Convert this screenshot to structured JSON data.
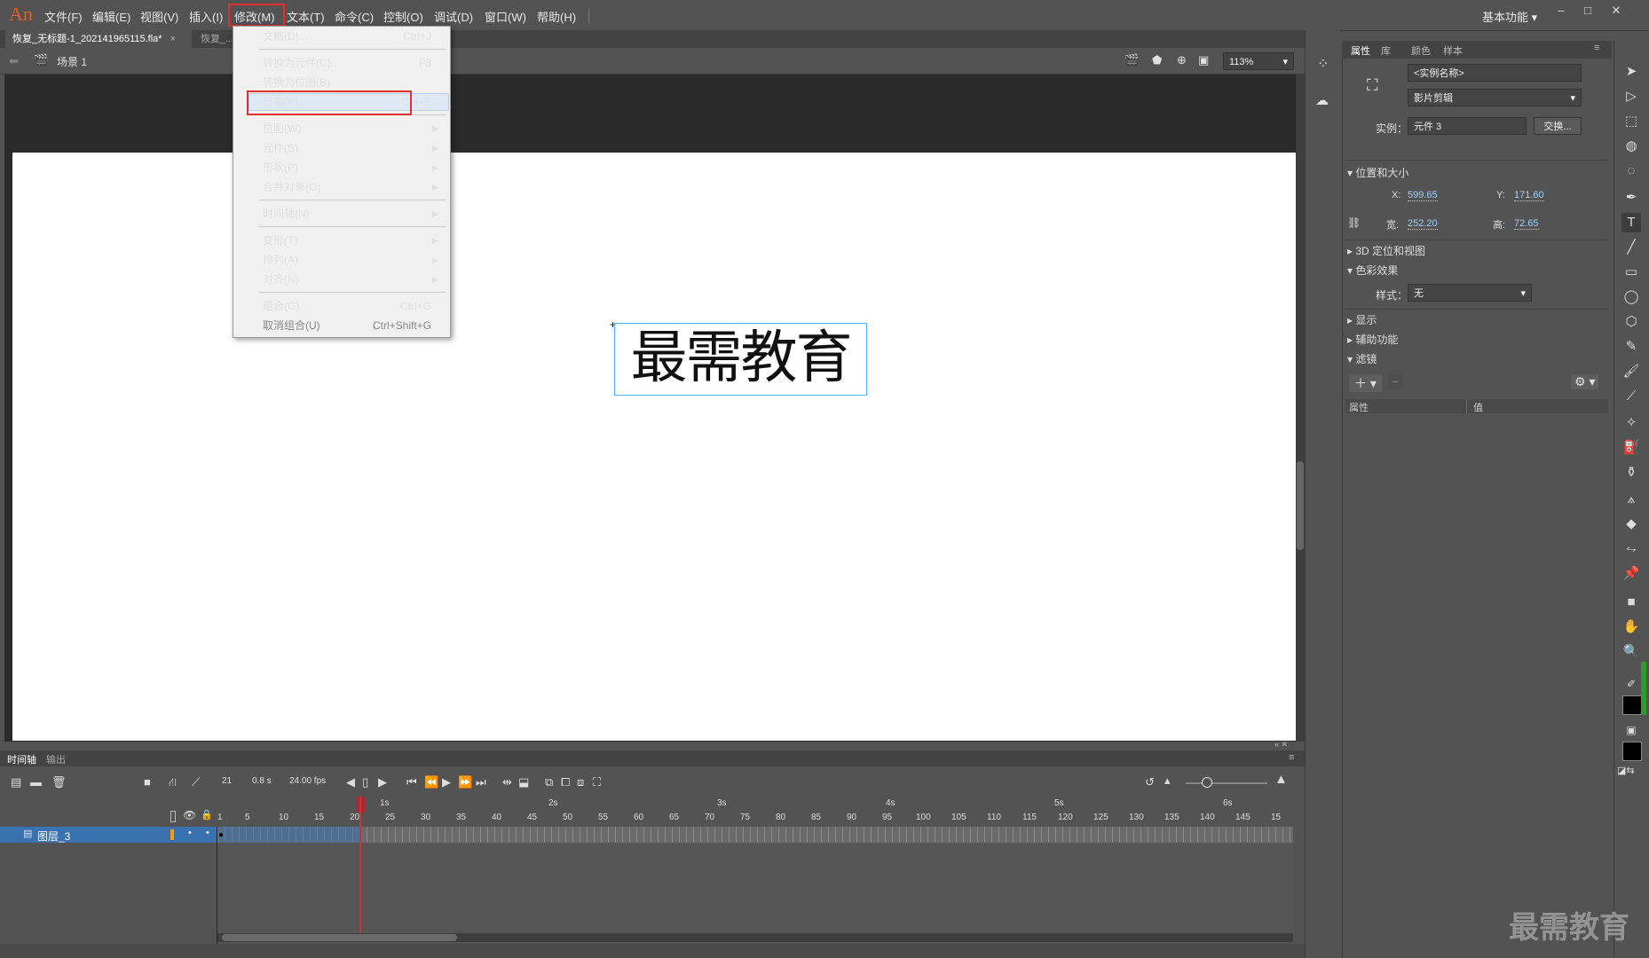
{
  "app": {
    "logo": "An",
    "menus": [
      "文件(F)",
      "编辑(E)",
      "视图(V)",
      "插入(I)",
      "修改(M)",
      "文本(T)",
      "命令(C)",
      "控制(O)",
      "调试(D)",
      "窗口(W)",
      "帮助(H)"
    ],
    "workspace": "基本功能",
    "window_buttons": [
      "–",
      "□",
      "✕"
    ]
  },
  "doc_tabs": {
    "active": "恢复_无标题-1_202141965115.fla*",
    "active_close": "×",
    "second": "恢复_..."
  },
  "scene": {
    "label": "场景 1",
    "zoom": "113%"
  },
  "stage": {
    "text": "最需教育"
  },
  "modify_menu": {
    "items": [
      {
        "label": "文档(D)...",
        "shortcut": "Ctrl+J"
      },
      {
        "label": "转换为元件(C)...",
        "shortcut": "F8"
      },
      {
        "label": "转换为位图(B)",
        "shortcut": ""
      },
      {
        "label": "分离(K)",
        "shortcut": "Ctrl+B"
      },
      {
        "label": "位图(W)",
        "submenu": true
      },
      {
        "label": "元件(S)",
        "submenu": true
      },
      {
        "label": "形状(P)",
        "submenu": true
      },
      {
        "label": "合并对象(O)",
        "submenu": true
      },
      {
        "label": "时间轴(N)",
        "submenu": true
      },
      {
        "label": "变形(T)",
        "submenu": true
      },
      {
        "label": "排列(A)",
        "submenu": true
      },
      {
        "label": "对齐(N)",
        "submenu": true
      },
      {
        "label": "组合(G)",
        "shortcut": "Ctrl+G"
      },
      {
        "label": "取消组合(U)",
        "shortcut": "Ctrl+Shift+G",
        "disabled": true
      }
    ],
    "highlighted": "分离(K)"
  },
  "properties": {
    "tabs": [
      "属性",
      "库",
      "颜色",
      "样本"
    ],
    "instance_name_placeholder": "<实例名称>",
    "symbol_type": "影片剪辑",
    "instance_label": "实例：",
    "instance_value": "元件 3",
    "swap_button": "交换...",
    "sections": {
      "position": "位置和大小",
      "three_d": "3D 定位和视图",
      "color": "色彩效果",
      "display": "显示",
      "accessibility": "辅助功能",
      "filters": "滤镜"
    },
    "x_label": "X:",
    "x": "599.65",
    "y_label": "Y:",
    "y": "171.60",
    "w_label": "宽:",
    "w": "252.20",
    "h_label": "高:",
    "h": "72.65",
    "style_label": "样式：",
    "style_value": "无",
    "filter_col_prop": "属性",
    "filter_col_value": "值"
  },
  "timeline": {
    "tabs": [
      "时间轴",
      "输出"
    ],
    "current_frame": "21",
    "elapsed": "0.8 s",
    "fps": "24.00 fps",
    "layer_name": "图层_3",
    "seconds": [
      "1s",
      "2s",
      "3s",
      "4s",
      "5s",
      "6s"
    ],
    "ticks": [
      "1",
      "5",
      "10",
      "15",
      "20",
      "25",
      "30",
      "35",
      "40",
      "45",
      "50",
      "55",
      "60",
      "65",
      "70",
      "75",
      "80",
      "85",
      "90",
      "95",
      "100",
      "105",
      "110",
      "115",
      "120",
      "125",
      "130",
      "135",
      "140",
      "145",
      "15"
    ]
  },
  "watermark": "最需教育"
}
